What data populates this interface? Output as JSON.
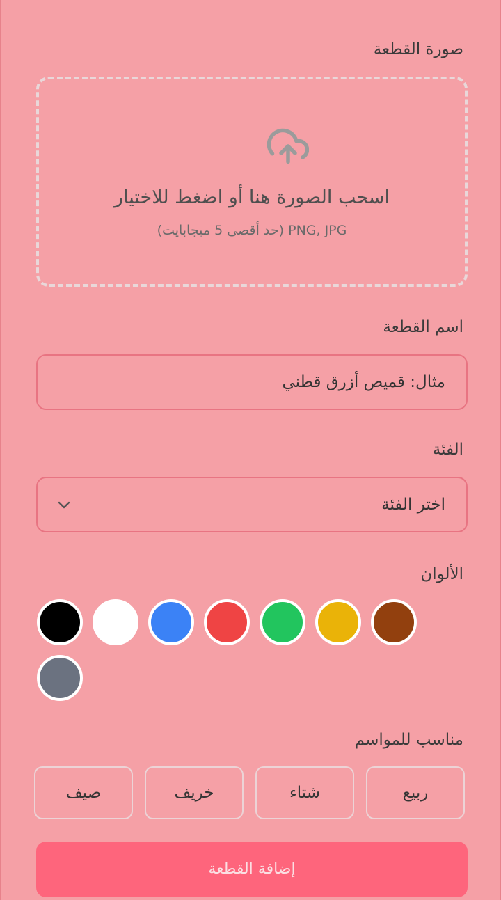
{
  "image_section": {
    "label": "صورة القطعة",
    "dropzone_title": "اسحب الصورة هنا أو اضغط للاختيار",
    "dropzone_subtitle": "PNG, JPG (حد أقصى 5 ميجابايت)",
    "icon": "cloud-upload-icon"
  },
  "name_section": {
    "label": "اسم القطعة",
    "placeholder": "مثال: قميص أزرق قطني"
  },
  "category_section": {
    "label": "الفئة",
    "selected": "اختر الفئة",
    "icon": "chevron-down-icon"
  },
  "colors_section": {
    "label": "الألوان",
    "swatches": [
      {
        "name": "black",
        "hex": "#000000"
      },
      {
        "name": "white",
        "hex": "#ffffff"
      },
      {
        "name": "blue",
        "hex": "#3b82f6"
      },
      {
        "name": "red",
        "hex": "#ef4444"
      },
      {
        "name": "green",
        "hex": "#22c55e"
      },
      {
        "name": "yellow",
        "hex": "#eab308"
      },
      {
        "name": "brown",
        "hex": "#92400e"
      },
      {
        "name": "gray",
        "hex": "#6b7280"
      }
    ]
  },
  "seasons_section": {
    "label": "مناسب للمواسم",
    "options": [
      "ربيع",
      "شتاء",
      "خريف",
      "صيف"
    ]
  },
  "submit": {
    "label": "إضافة القطعة"
  },
  "theme": {
    "background": "#f5a0a6",
    "accent": "#fe657c",
    "field_border": "#e87482"
  }
}
